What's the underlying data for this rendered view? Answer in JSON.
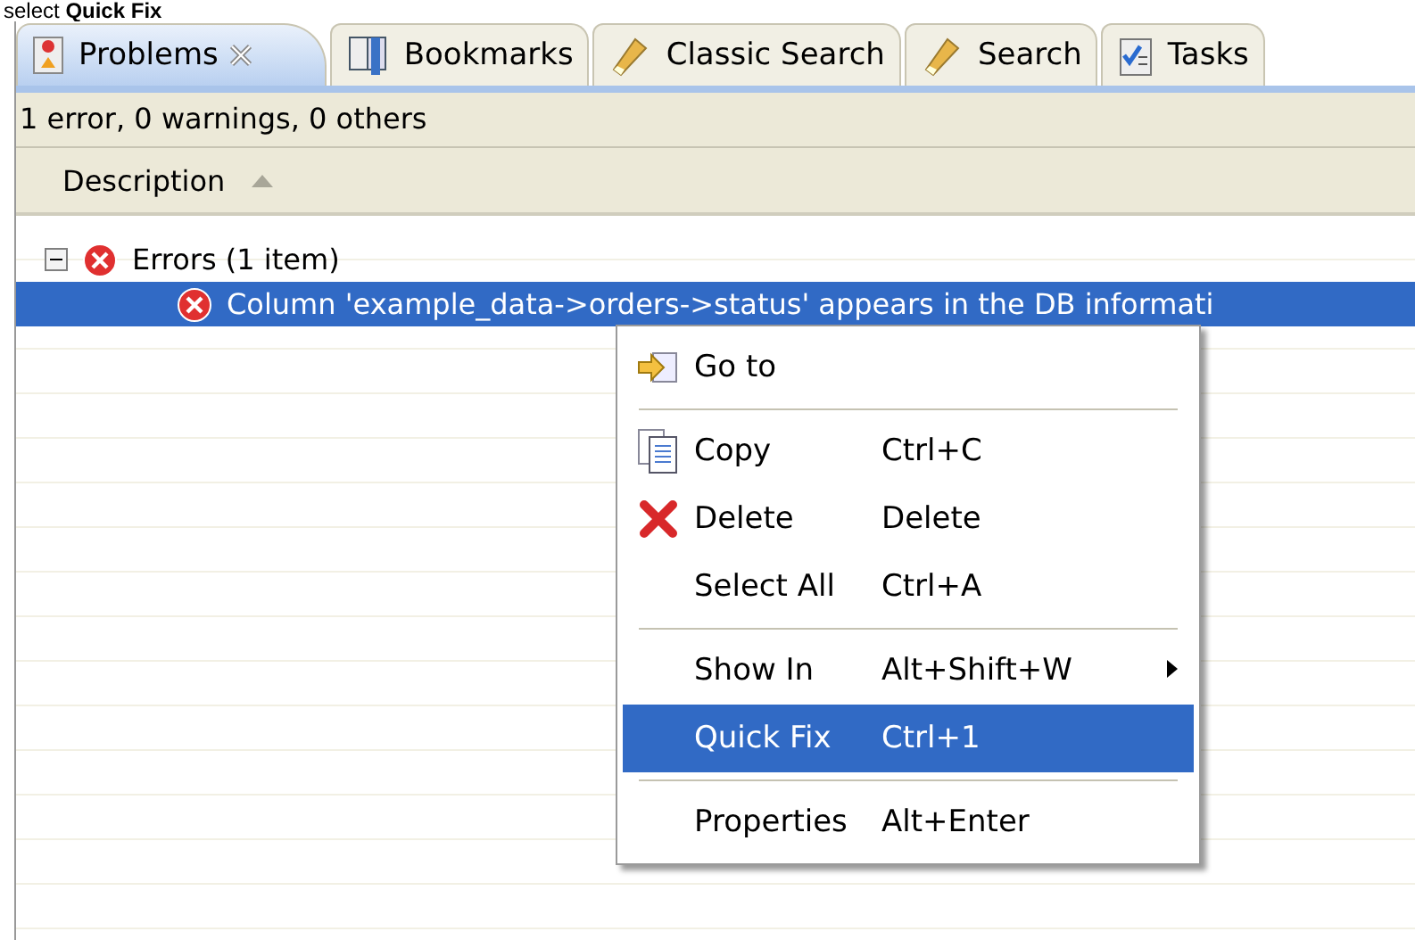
{
  "caption": "select **Quick Fix**",
  "tabs": [
    {
      "label": "Problems",
      "selected": true,
      "closable": true
    },
    {
      "label": "Bookmarks",
      "selected": false,
      "closable": false
    },
    {
      "label": "Classic Search",
      "selected": false,
      "closable": false
    },
    {
      "label": "Search",
      "selected": false,
      "closable": false
    },
    {
      "label": "Tasks",
      "selected": false,
      "closable": false
    }
  ],
  "summary": "1 error, 0 warnings, 0 others",
  "table": {
    "columns": [
      {
        "label": "Description",
        "sorted": true
      }
    ],
    "rows": [
      {
        "label": "Errors (1 item)",
        "expanded": true,
        "selected": false,
        "children": [
          {
            "label": "Column 'example_data->orders->status' appears in the DB informati",
            "selected": true
          }
        ]
      }
    ]
  },
  "context_menu": {
    "items": [
      {
        "kind": "item",
        "label": "Go to",
        "selected": false
      },
      {
        "kind": "separator"
      },
      {
        "kind": "item",
        "label": "Copy",
        "shortcut": "Ctrl+C",
        "selected": false
      },
      {
        "kind": "item",
        "label": "Delete",
        "shortcut": "Delete",
        "selected": false
      },
      {
        "kind": "item",
        "label": "Select All",
        "shortcut": "Ctrl+A",
        "selected": false
      },
      {
        "kind": "separator"
      },
      {
        "kind": "item",
        "label": "Show In",
        "shortcut": "Alt+Shift+W",
        "submenu": true,
        "selected": false
      },
      {
        "kind": "item",
        "label": "Quick Fix",
        "shortcut": "Ctrl+1",
        "selected": true
      },
      {
        "kind": "separator"
      },
      {
        "kind": "item",
        "label": "Properties",
        "shortcut": "Alt+Enter",
        "selected": false
      }
    ]
  }
}
